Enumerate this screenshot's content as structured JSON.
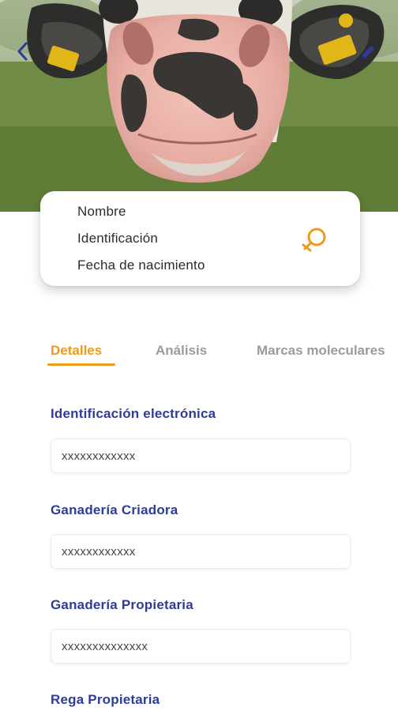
{
  "header": {
    "photo": "cow-nose-closeup",
    "back_icon": "chevron-left-icon",
    "edit_icon": "pencil-icon"
  },
  "animal_card": {
    "name": "Nombre",
    "identification": "Identificación",
    "birth_date": "Fecha de nacimiento",
    "sex_icon": "female-sign-icon",
    "sex_icon_color": "#ef9a1a"
  },
  "tabs": [
    {
      "label": "Detalles",
      "active": true
    },
    {
      "label": "Análisis",
      "active": false
    },
    {
      "label": "Marcas moleculares",
      "active": false
    }
  ],
  "fields": [
    {
      "label": "Identificación electrónica",
      "value": "xxxxxxxxxxxx"
    },
    {
      "label": "Ganadería Criadora",
      "value": "xxxxxxxxxxxx"
    },
    {
      "label": "Ganadería Propietaria",
      "value": "xxxxxxxxxxxxxx"
    },
    {
      "label": "Rega Propietaria",
      "value": ""
    }
  ],
  "colors": {
    "accent": "#ef9a1a",
    "label": "#2e3c98",
    "inactive_tab": "#9b9b9b",
    "nav_icon": "#2e3c98"
  }
}
